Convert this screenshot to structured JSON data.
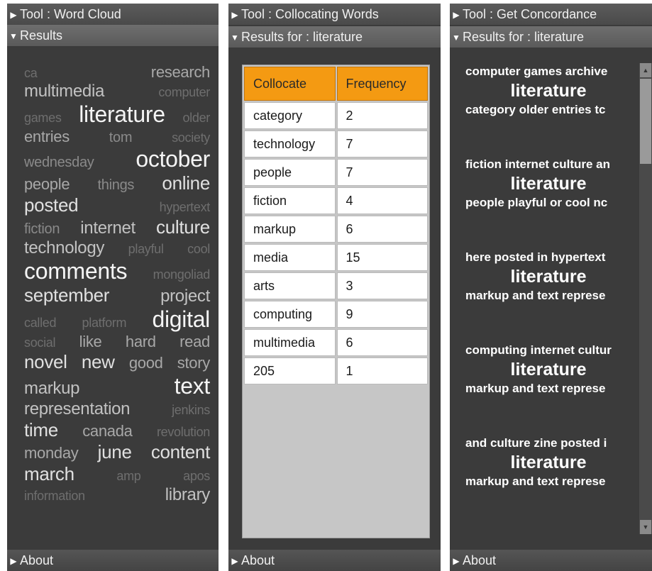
{
  "word_cloud_panel": {
    "tool_title": "Tool : Word Cloud",
    "results_title": "Results",
    "about_label": "About",
    "lines": [
      [
        {
          "t": "ca",
          "s": 1
        },
        {
          "t": "research",
          "s": 3
        }
      ],
      [
        {
          "t": "multimedia",
          "s": 4
        },
        {
          "t": "computer",
          "s": 1
        }
      ],
      [
        {
          "t": "games",
          "s": 1
        },
        {
          "t": "literature",
          "s": 6
        },
        {
          "t": "older",
          "s": 1
        }
      ],
      [
        {
          "t": "entries",
          "s": 3
        },
        {
          "t": "tom",
          "s": 2
        },
        {
          "t": "society",
          "s": 1
        }
      ],
      [
        {
          "t": "wednesday",
          "s": 2
        },
        {
          "t": "october",
          "s": 6
        }
      ],
      [
        {
          "t": "people",
          "s": 3
        },
        {
          "t": "things",
          "s": 2
        },
        {
          "t": "online",
          "s": 5
        }
      ],
      [
        {
          "t": "posted",
          "s": 5
        },
        {
          "t": "hypertext",
          "s": 1
        }
      ],
      [
        {
          "t": "fiction",
          "s": 2
        },
        {
          "t": "internet",
          "s": 4
        },
        {
          "t": "culture",
          "s": 5
        }
      ],
      [
        {
          "t": "technology",
          "s": 4
        },
        {
          "t": "playful",
          "s": 1
        },
        {
          "t": "cool",
          "s": 1
        }
      ],
      [
        {
          "t": "comments",
          "s": 6
        },
        {
          "t": "mongoliad",
          "s": 1
        }
      ],
      [
        {
          "t": "september",
          "s": 5
        },
        {
          "t": "project",
          "s": 4
        }
      ],
      [
        {
          "t": "called",
          "s": 1
        },
        {
          "t": "platform",
          "s": 1
        },
        {
          "t": "digital",
          "s": 6
        }
      ],
      [
        {
          "t": "social",
          "s": 1
        },
        {
          "t": "like",
          "s": 3
        },
        {
          "t": "hard",
          "s": 3
        },
        {
          "t": "read",
          "s": 3
        }
      ],
      [
        {
          "t": "novel",
          "s": 5
        },
        {
          "t": "new",
          "s": 5
        },
        {
          "t": "good",
          "s": 3
        },
        {
          "t": "story",
          "s": 3
        }
      ],
      [
        {
          "t": "markup",
          "s": 4
        },
        {
          "t": "text",
          "s": 6
        }
      ],
      [
        {
          "t": "representation",
          "s": 4
        },
        {
          "t": "jenkins",
          "s": 1
        }
      ],
      [
        {
          "t": "time",
          "s": 5
        },
        {
          "t": "canada",
          "s": 3
        },
        {
          "t": "revolution",
          "s": 1
        }
      ],
      [
        {
          "t": "monday",
          "s": 3
        },
        {
          "t": "june",
          "s": 5
        },
        {
          "t": "content",
          "s": 5
        }
      ],
      [
        {
          "t": "march",
          "s": 5
        },
        {
          "t": "amp",
          "s": 1
        },
        {
          "t": "apos",
          "s": 1
        }
      ],
      [
        {
          "t": "information",
          "s": 1
        },
        {
          "t": "library",
          "s": 4
        }
      ]
    ]
  },
  "collocate_panel": {
    "tool_title": "Tool : Collocating Words",
    "results_title": "Results for : literature",
    "about_label": "About",
    "columns": [
      "Collocate",
      "Frequency"
    ],
    "rows": [
      [
        "category",
        "2"
      ],
      [
        "technology",
        "7"
      ],
      [
        "people",
        "7"
      ],
      [
        "fiction",
        "4"
      ],
      [
        "markup",
        "6"
      ],
      [
        "media",
        "15"
      ],
      [
        "arts",
        "3"
      ],
      [
        "computing",
        "9"
      ],
      [
        "multimedia",
        "6"
      ],
      [
        "205",
        "1"
      ]
    ]
  },
  "concordance_panel": {
    "tool_title": "Tool : Get Concordance",
    "results_title": "Results for : literature",
    "about_label": "About",
    "entries": [
      {
        "before": "computer games archive",
        "keyword": "literature",
        "after": "category older entries tc"
      },
      {
        "before": "fiction internet culture an",
        "keyword": "literature",
        "after": "people playful or cool nc"
      },
      {
        "before": "here posted in hypertext",
        "keyword": "literature",
        "after": "markup and text represe"
      },
      {
        "before": "computing internet cultur",
        "keyword": "literature",
        "after": "markup and text represe"
      },
      {
        "before": "and culture zine posted i",
        "keyword": "literature",
        "after": "markup and text represe"
      }
    ]
  }
}
